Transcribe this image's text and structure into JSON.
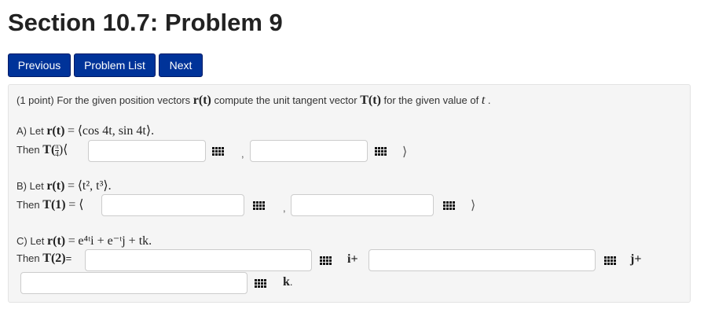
{
  "page": {
    "title": "Section 10.7: Problem 9"
  },
  "nav": {
    "previous": "Previous",
    "problem_list": "Problem List",
    "next": "Next"
  },
  "problem": {
    "points": "(1 point)",
    "intro_before_r": "For the given position vectors",
    "intro_mid": "compute the unit tangent vector",
    "intro_after_T": "for the given value of",
    "r_of_t": "r(t)",
    "T_of_t": "T(t)",
    "t": "t",
    "period": ".",
    "parts": [
      {
        "label": "A) Let",
        "r_symbol": "r(t)",
        "equals": "=",
        "expr": "⟨cos 4t, sin 4t⟩.",
        "then": "Then",
        "T_symbol": "T(",
        "frac_num": "π",
        "frac_den": "4",
        "T_close": ")⟨",
        "comma": ",",
        "close": "⟩"
      },
      {
        "label": "B) Let",
        "r_symbol": "r(t)",
        "equals": "=",
        "expr": "⟨t², t³⟩.",
        "then": "Then",
        "T_symbol": "T(1)",
        "T_close": "= ⟨",
        "comma": ",",
        "close": "⟩"
      },
      {
        "label": "C) Let",
        "r_symbol": "r(t)",
        "equals": "=",
        "expr": "e⁴ᵗi + e⁻ᵗj + tk.",
        "then": "Then",
        "T_symbol": "T(2)",
        "T_close": "=",
        "i_unit": "i+",
        "j_unit": "j+",
        "k_unit": "k",
        "k_period": "."
      }
    ]
  },
  "icons": {
    "palette": "equation-editor-grid-icon"
  },
  "colors": {
    "button_bg": "#003399",
    "panel_bg": "#f5f5f5",
    "input_border": "#cccccc"
  }
}
